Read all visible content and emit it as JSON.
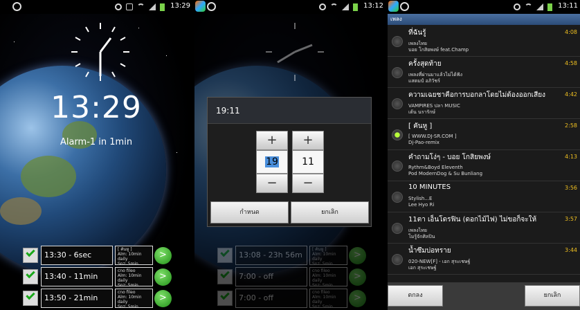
{
  "panel1": {
    "status_time": "13:29",
    "big_time": "13:29",
    "alarm_label": "Alarm-1 in 1min",
    "alarms": [
      {
        "time": "13:30 - 6sec",
        "info1": "[ คันหู ]",
        "info2": "Alm: 10min daily",
        "info3": "Snz: 5min",
        "checked": true
      },
      {
        "time": "13:40 - 11min",
        "info1": "cno fileo",
        "info2": "Alm: 10min daily",
        "info3": "Snz: 5min",
        "checked": true
      },
      {
        "time": "13:50 - 21min",
        "info1": "cno fileo",
        "info2": "Alm: 10min daily",
        "info3": "Snz: 5min",
        "checked": true
      }
    ]
  },
  "panel2": {
    "status_time": "13:12",
    "dialog_title": "19:11",
    "hour_value": "19",
    "minute_value": "11",
    "plus": "+",
    "minus": "−",
    "ok_label": "กำหนด",
    "cancel_label": "ยกเลิก",
    "alarms": [
      {
        "time": "13:08 - 23h 56m",
        "info1": "[ คันหู ]",
        "info2": "Alm: 10min daily",
        "info3": "Snz: 5min"
      },
      {
        "time": "7:00 - off",
        "info1": "cno fileo",
        "info2": "Alm: 10min daily",
        "info3": "Snz: 5min"
      },
      {
        "time": "7:00 - off",
        "info1": "cno fileo",
        "info2": "Alm: 10min daily",
        "info3": "Snz: 5min"
      }
    ]
  },
  "panel3": {
    "status_time": "13:11",
    "header": "เพลง",
    "songs": [
      {
        "title": "ที่ฉันรู้",
        "line1": "เพลงไทย",
        "line2": "บอย โกสิยพงษ์ feat.Champ",
        "duration": "4:08",
        "selected": false
      },
      {
        "title": "ครั้งสุดท้าย",
        "line1": "เพลงที่ผ่านมาแล้วไม่ได้ฟัง",
        "line2": "แสตมป์ อภิวัชร์",
        "duration": "4:58",
        "selected": false
      },
      {
        "title": "ความเฉยชาคือการบอกลาโดยไม่ต้องออกเสียง",
        "line1": "VAMPIRES ปลา MUSIC",
        "line2": "เต้น นรารักษ์",
        "duration": "4:42",
        "selected": false
      },
      {
        "title": "[ คันหู ]",
        "line1": "[ WWW.DJ-SR.COM ]",
        "line2": "Dj-Pao-remix",
        "duration": "2:58",
        "selected": true
      },
      {
        "title": "คำถามโง่ๆ - บอย โกสิยพงษ์",
        "line1": "Rythm&Boyd Eleventh",
        "line2": "Pod ModernDog & Su Bunliang",
        "duration": "4:13",
        "selected": false
      },
      {
        "title": "10 MINUTES",
        "line1": "Stylish...E",
        "line2": "Lee Hyo Ri",
        "duration": "3:56",
        "selected": false
      },
      {
        "title": "11ตา เอ็นโดรฟิน (ดอกไม้ไฟ) ไม่ขอก็จะให้",
        "line1": "เพลงไทย",
        "line2": "โมรู้จักศิลปิน",
        "duration": "3:57",
        "selected": false
      },
      {
        "title": "น้ำซึมบ่อทราย",
        "line1": "020-NEW[F] - เอก สุระเชษฐ์",
        "line2": "เอก สุระเชษฐ์",
        "duration": "3:44",
        "selected": false
      }
    ],
    "ok_label": "ตกลง",
    "cancel_label": "ยกเลิก"
  },
  "colors": {
    "accent_green": "#1aa81a",
    "header_blue": "#3b5f8f",
    "duration_yellow": "#f0c020"
  }
}
